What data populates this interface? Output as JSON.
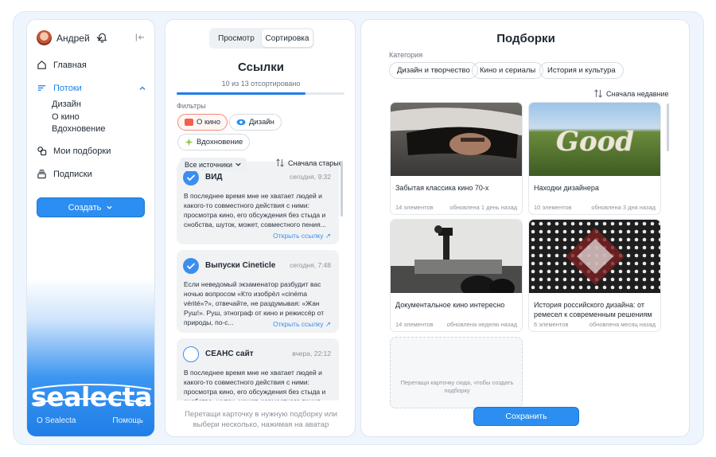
{
  "sidebar": {
    "user_name": "Андрей",
    "nav": {
      "home": "Главная",
      "streams": "Потоки",
      "streams_sub": [
        "Дизайн",
        "О кино",
        "Вдохновение"
      ],
      "my_collections": "Мои подборки",
      "subscriptions": "Подписки"
    },
    "create_label": "Создать",
    "logo_text": "sealecta",
    "footer_about": "О Sealecta",
    "footer_help": "Помощь"
  },
  "links": {
    "tabs": [
      "Просмотр",
      "Сортировка"
    ],
    "active_tab": "Сортировка",
    "title": "Ссылки",
    "sorted_text": "10 из 13 отсортировано",
    "progress": 0.77,
    "filters_label": "Фильтры",
    "filters": [
      "О кино",
      "Дизайн",
      "Вдохновение"
    ],
    "source_select": "Все источники",
    "sort_label": "Сначала старые",
    "cards": [
      {
        "title": "ВИД",
        "time": "сегодня, 9:32",
        "text": "В последнее время мне не хватает людей и какого-то совместного действия с ними: просмотра кино, его обсуждения без стыда и снобства, шуток, может, совместного пения...",
        "link": "Открыть ссылку",
        "checked": true
      },
      {
        "title": "Выпуски Cineticle",
        "time": "сегодня, 7:48",
        "text": "Если неведомый экзаменатор разбудит вас ночью вопросом «Кто изобрёл «cinéma vérité»?», отвечайте, не раздумывая: «Жан Руш!». Руш, этнограф от кино и режиссёр от природы, по-с...",
        "link": "Открыть ссылку",
        "checked": true
      },
      {
        "title": "СЕАНС сайт",
        "time": "вчера, 22:12",
        "text": "В последнее время мне не хватает людей и какого-то совместного действия с ними: просмотра кино, его обсуждения без стыда и снобства, шуток, может, совместного пения",
        "link": "",
        "checked": false
      }
    ],
    "hint": "Перетащи карточку в нужную подборку или выбери несколько, нажимая на аватар"
  },
  "collections": {
    "title": "Подборки",
    "category_label": "Категория",
    "categories": [
      "Дизайн и творчество",
      "Кино и сериалы",
      "История и культура"
    ],
    "sort_label": "Сначала недавние",
    "items": [
      {
        "name": "Забытая классика кино 70-х",
        "count": "14 элементов",
        "updated": "обновлена 1 день назад"
      },
      {
        "name": "Находки дизайнера",
        "count": "10 элементов",
        "updated": "обновлена 3 дня назад"
      },
      {
        "name": "Документальное кино интересно",
        "count": "14 элементов",
        "updated": "обновлена неделю назад"
      },
      {
        "name": "История российского дизайна: от ремесел к современным решениям",
        "count": "6 элементов",
        "updated": "обновлена месяц назад"
      }
    ],
    "drop_hint": "Перетащи карточку сюда, чтобы создать подборку",
    "save_label": "Сохранить",
    "tile_image_text": "Good"
  }
}
